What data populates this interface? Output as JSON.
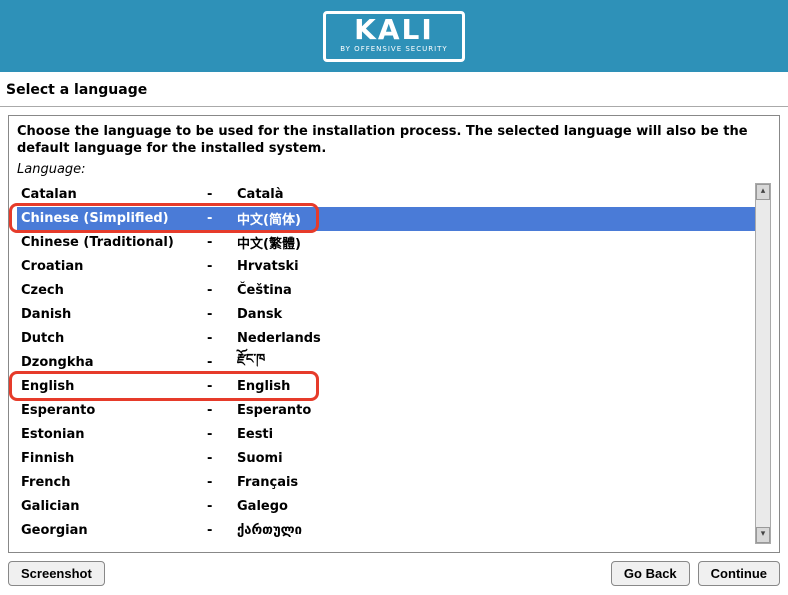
{
  "header": {
    "logo_title": "KALI",
    "logo_sub": "BY OFFENSIVE SECURITY"
  },
  "section_title": "Select a language",
  "description": "Choose the language to be used for the installation process. The selected language will also be the default language for the installed system.",
  "field_label": "Language:",
  "selected_index": 1,
  "highlight_red_indices": [
    1,
    8
  ],
  "languages": [
    {
      "en": "Catalan",
      "nat": "Català"
    },
    {
      "en": "Chinese (Simplified)",
      "nat": "中文(简体)"
    },
    {
      "en": "Chinese (Traditional)",
      "nat": "中文(繁體)"
    },
    {
      "en": "Croatian",
      "nat": "Hrvatski"
    },
    {
      "en": "Czech",
      "nat": "Čeština"
    },
    {
      "en": "Danish",
      "nat": "Dansk"
    },
    {
      "en": "Dutch",
      "nat": "Nederlands"
    },
    {
      "en": "Dzongkha",
      "nat": "རྫོང་ཁ"
    },
    {
      "en": "English",
      "nat": "English"
    },
    {
      "en": "Esperanto",
      "nat": "Esperanto"
    },
    {
      "en": "Estonian",
      "nat": "Eesti"
    },
    {
      "en": "Finnish",
      "nat": "Suomi"
    },
    {
      "en": "French",
      "nat": "Français"
    },
    {
      "en": "Galician",
      "nat": "Galego"
    },
    {
      "en": "Georgian",
      "nat": "ქართული"
    }
  ],
  "buttons": {
    "screenshot": "Screenshot",
    "go_back": "Go Back",
    "continue": "Continue"
  },
  "scrollbar": {
    "up": "▴",
    "down": "▾"
  }
}
